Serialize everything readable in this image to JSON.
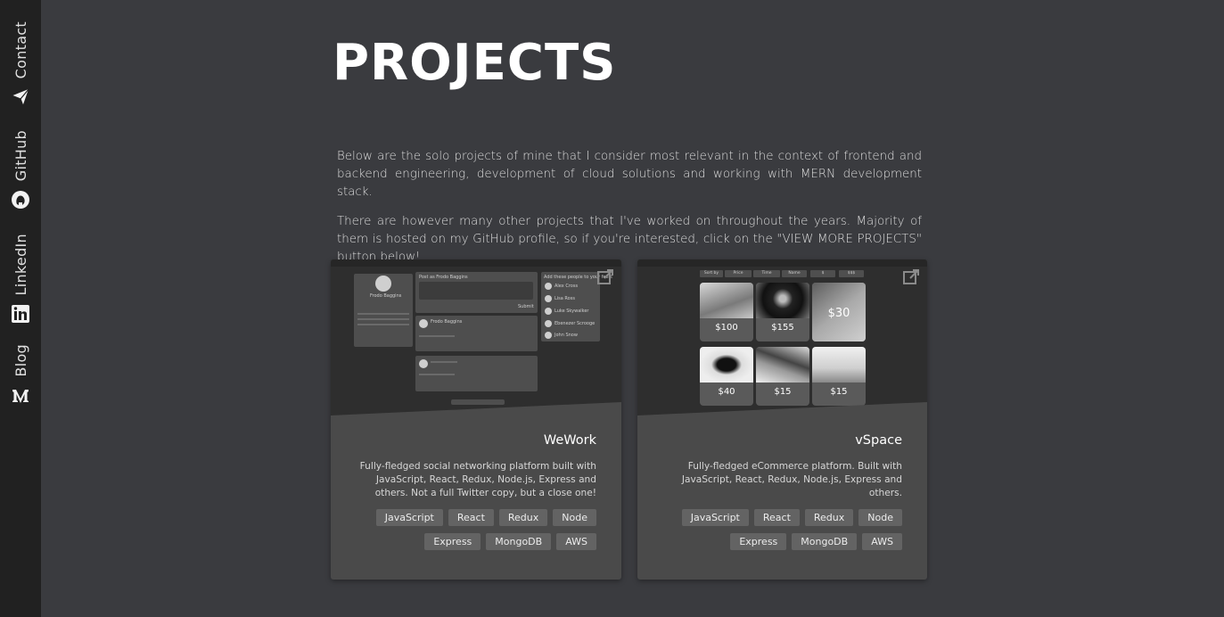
{
  "sidebar": {
    "items": [
      {
        "label": "Contact",
        "icon": "paper-plane-icon"
      },
      {
        "label": "GitHub",
        "icon": "github-icon"
      },
      {
        "label": "LinkedIn",
        "icon": "linkedin-icon"
      },
      {
        "label": "Blog",
        "icon": "medium-icon"
      }
    ]
  },
  "page": {
    "title": "PROJECTS",
    "intro": [
      "Below are the solo projects of mine that I consider most relevant in the context of frontend and backend engineering, development of cloud solutions and working with MERN development stack.",
      "There are however many other projects that I've worked on throughout the years. Majority of them is hosted on my GitHub profile, so if you're interested, click on the \"VIEW MORE PROJECTS\" button below!"
    ]
  },
  "projects": [
    {
      "title": "WeWork",
      "description": "Fully-fledged social networking platform built with JavaScript, React, Redux, Node.js, Express and others. Not a full Twitter copy, but a close one!",
      "tags": [
        "JavaScript",
        "React",
        "Redux",
        "Node",
        "Express",
        "MongoDB",
        "AWS"
      ],
      "preview": {
        "profile_name": "Frodo Baggins",
        "post_author": "Frodo Baggins",
        "post_placeholder": "Post as Frodo Baggins",
        "follow_header": "Add these people to your feed:",
        "follow": [
          "Alex Cross",
          "Lisa Ross",
          "Luke Skywalker",
          "Ebenezer Scrooge",
          "John Snow"
        ],
        "submit": "Submit",
        "load_more": "Load more"
      }
    },
    {
      "title": "vSpace",
      "description": "Fully-fledged eCommerce platform. Built with JavaScript, React, Redux, Node.js, Express and others.",
      "tags": [
        "JavaScript",
        "React",
        "Redux",
        "Node",
        "Express",
        "MongoDB",
        "AWS"
      ],
      "preview": {
        "filters": [
          "Sort by",
          "Price",
          "Time",
          "Name",
          "$",
          "$$$"
        ],
        "prices": [
          "$100",
          "$155",
          "$30",
          "$40",
          "$15",
          "$15"
        ]
      }
    }
  ]
}
